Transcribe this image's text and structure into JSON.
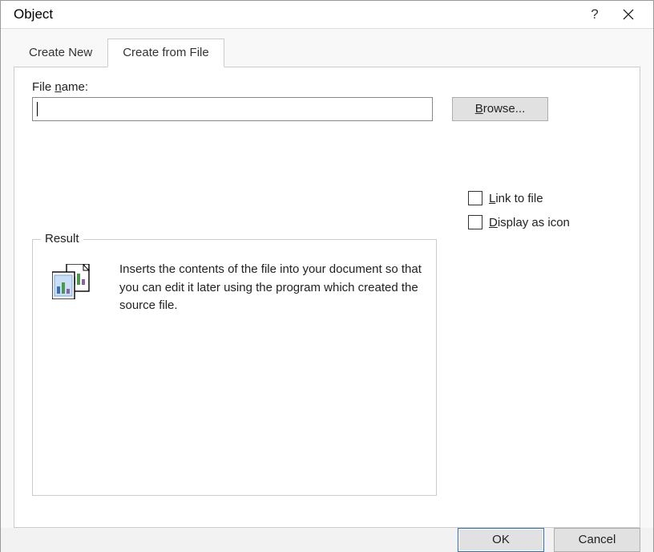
{
  "title": "Object",
  "tabs": {
    "create_new": "Create New",
    "create_from_file": "Create from File"
  },
  "file_name_label": "File name:",
  "file_name_value": "",
  "browse_label": "Browse...",
  "link_to_file_label": "Link to file",
  "display_as_icon_label": "Display as icon",
  "result_legend": "Result",
  "result_text": "Inserts the contents of the file into your document so that you can edit it later using the program which created the source file.",
  "ok_label": "OK",
  "cancel_label": "Cancel",
  "hotkeys": {
    "file_name_underline_char": "n",
    "browse_underline_char": "B",
    "link_underline_char": "L",
    "display_underline_char": "D"
  }
}
